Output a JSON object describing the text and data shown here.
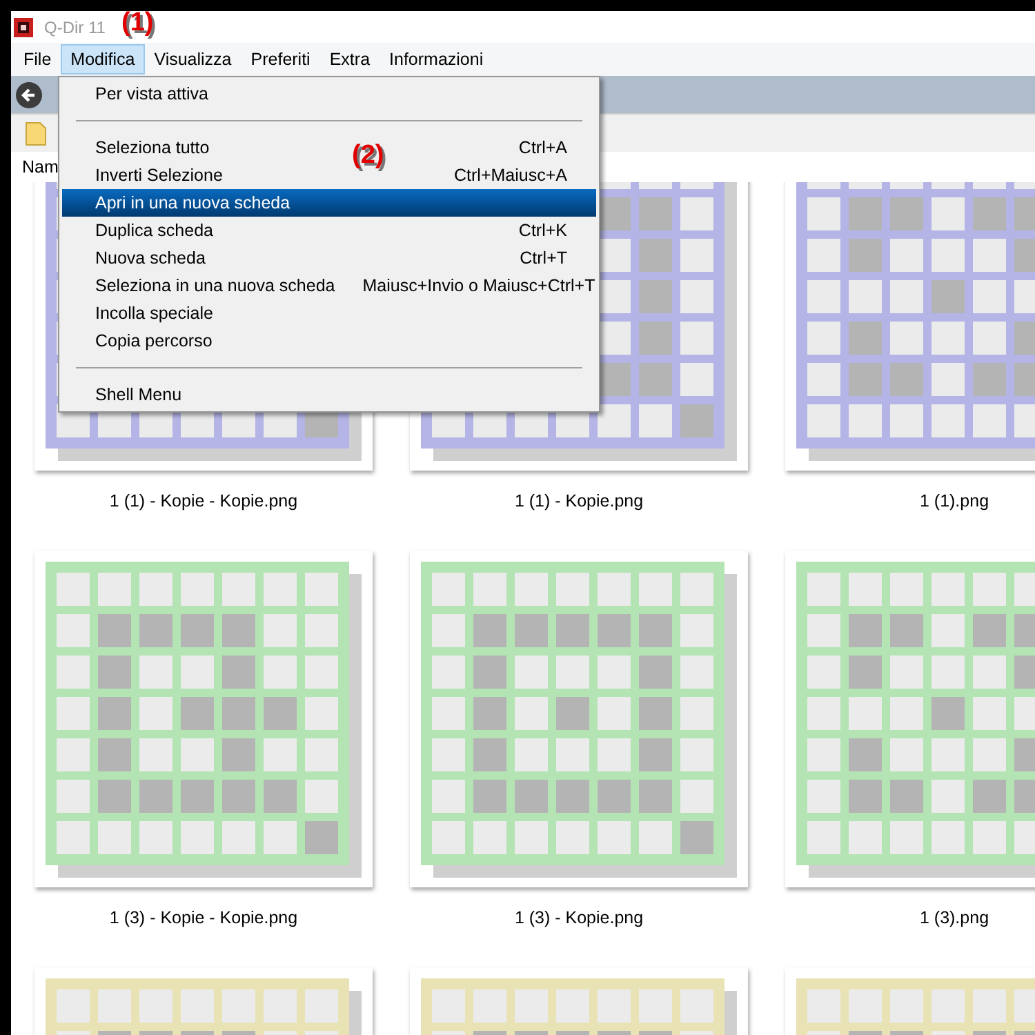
{
  "window": {
    "title": "Q-Dir 11"
  },
  "menu_bar": [
    {
      "label": "File",
      "selected": false
    },
    {
      "label": "Modifica",
      "selected": true
    },
    {
      "label": "Visualizza",
      "selected": false
    },
    {
      "label": "Preferiti",
      "selected": false
    },
    {
      "label": "Extra",
      "selected": false
    },
    {
      "label": "Informazioni",
      "selected": false
    }
  ],
  "dropdown": [
    {
      "kind": "item",
      "label": "Per vista attiva",
      "selected": false
    },
    {
      "kind": "separator"
    },
    {
      "kind": "item",
      "label": "Seleziona tutto",
      "shortcut": "Ctrl+A",
      "selected": false
    },
    {
      "kind": "item",
      "label": "Inverti Selezione",
      "shortcut": "Ctrl+Maiusc+A",
      "selected": false
    },
    {
      "kind": "item",
      "label": "Apri in una nuova scheda",
      "selected": true
    },
    {
      "kind": "item",
      "label": "Duplica scheda",
      "shortcut": "Ctrl+K",
      "selected": false
    },
    {
      "kind": "item",
      "label": "Nuova scheda",
      "shortcut": "Ctrl+T",
      "selected": false
    },
    {
      "kind": "item",
      "label": "Seleziona in una nuova scheda",
      "shortcut": "Maiusc+Invio o Maiusc+Ctrl+T",
      "selected": false
    },
    {
      "kind": "item",
      "label": "Incolla speciale",
      "selected": false
    },
    {
      "kind": "item",
      "label": "Copia percorso",
      "selected": false
    },
    {
      "kind": "separator"
    },
    {
      "kind": "item",
      "label": "Shell Menu",
      "selected": false
    }
  ],
  "column_header": "Nam",
  "thumbnails": [
    {
      "label": "1 (1) - Kopie - Kopie.png",
      "color": "#b4b4e6"
    },
    {
      "label": "1 (1) - Kopie.png",
      "color": "#b4b4e6"
    },
    {
      "label": "1 (1).png",
      "color": "#b4b4e6"
    },
    {
      "label": "1 (3) - Kopie - Kopie.png",
      "color": "#b4e4b4"
    },
    {
      "label": "1 (3) - Kopie.png",
      "color": "#b4e4b4"
    },
    {
      "label": "1 (3).png",
      "color": "#b4e4b4"
    },
    {
      "color": "#e8e2b4"
    },
    {
      "color": "#e8e2b4"
    },
    {
      "color": "#e8e2b4"
    }
  ],
  "annotations": [
    "(1)",
    "(2)"
  ]
}
